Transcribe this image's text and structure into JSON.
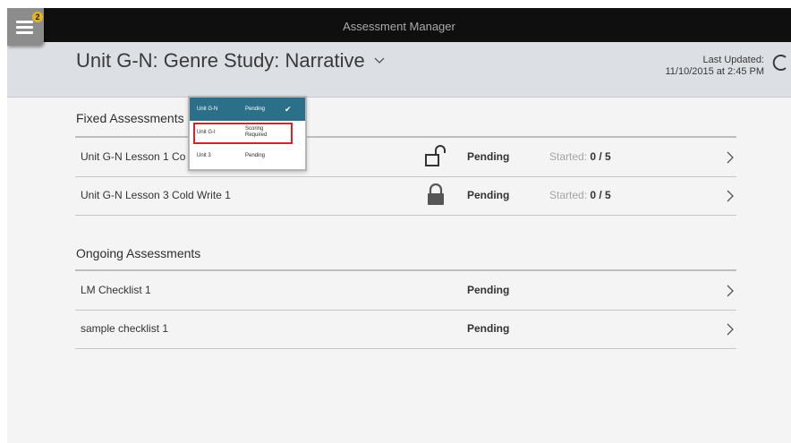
{
  "app": {
    "title": "Assessment Manager",
    "notification_count": "2"
  },
  "header": {
    "unit_title": "Unit G-N: Genre Study: Narrative",
    "last_updated_label": "Last Updated:",
    "last_updated_value": "11/10/2015 at 2:45 PM"
  },
  "dropdown": {
    "items": [
      {
        "unit": "Unit G-N",
        "status": "Pending",
        "selected": true
      },
      {
        "unit": "Unit G-I",
        "status_line1": "Scoring",
        "status_line2": "Required",
        "highlighted": true
      },
      {
        "unit": "Unit 3",
        "status": "Pending"
      }
    ]
  },
  "fixed": {
    "title": "Fixed Assessments",
    "rows": [
      {
        "name": "Unit G-N Lesson 1 Co",
        "lock": "unlocked",
        "status": "Pending",
        "started_label": "Started:",
        "started_value": "0 / 5"
      },
      {
        "name": "Unit G-N Lesson 3 Cold Write 1",
        "lock": "locked",
        "status": "Pending",
        "started_label": "Started:",
        "started_value": "0 / 5"
      }
    ]
  },
  "ongoing": {
    "title": "Ongoing Assessments",
    "rows": [
      {
        "name": "LM Checklist 1",
        "status": "Pending"
      },
      {
        "name": "sample checklist 1",
        "status": "Pending"
      }
    ]
  },
  "colors": {
    "selected_item": "#2b6f88",
    "highlight_border": "#d62229",
    "badge": "#e5b520"
  }
}
